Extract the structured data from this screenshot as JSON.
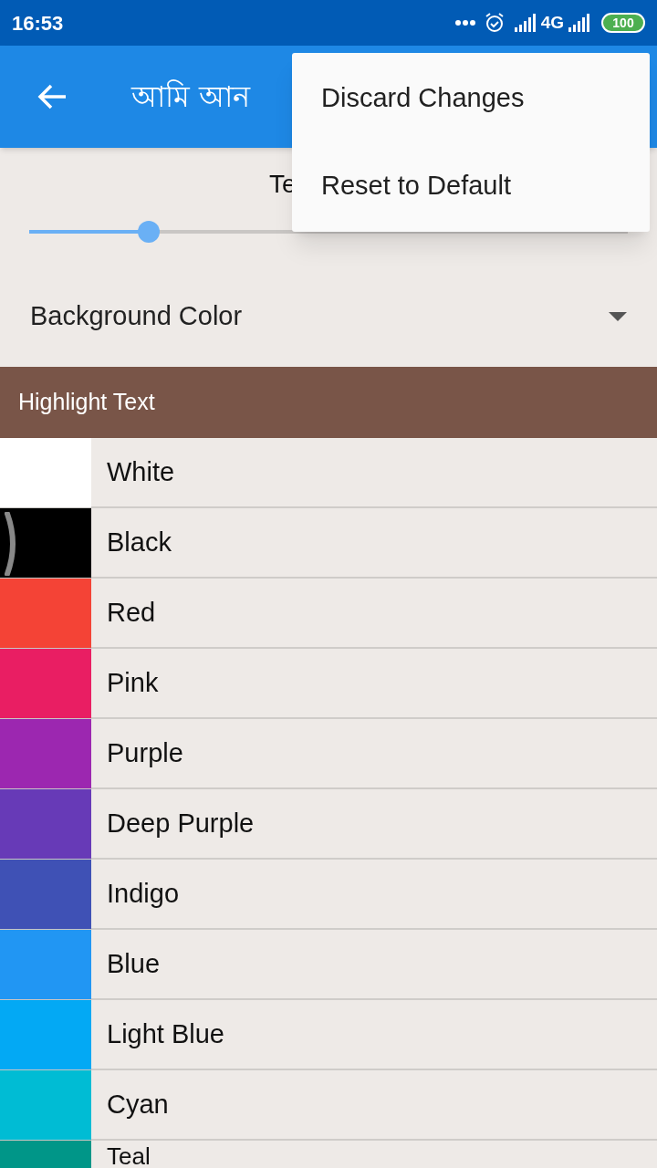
{
  "status_bar": {
    "time": "16:53",
    "network": "4G",
    "battery": "100"
  },
  "app_bar": {
    "title": "আমি আন"
  },
  "menu": {
    "items": [
      "Discard Changes",
      "Reset to Default"
    ]
  },
  "text_size": {
    "label": "Te",
    "level": 0.2
  },
  "background_color": {
    "label": "Background Color"
  },
  "section": {
    "title": "Highlight Text"
  },
  "colors": [
    {
      "label": "White",
      "color": "#ffffff"
    },
    {
      "label": "Black",
      "color": "#000000"
    },
    {
      "label": "Red",
      "color": "#f44336"
    },
    {
      "label": "Pink",
      "color": "#e91e63"
    },
    {
      "label": "Purple",
      "color": "#9c27b0"
    },
    {
      "label": "Deep Purple",
      "color": "#673ab7"
    },
    {
      "label": "Indigo",
      "color": "#3f51b5"
    },
    {
      "label": "Blue",
      "color": "#2196f3"
    },
    {
      "label": "Light Blue",
      "color": "#03a9f4"
    },
    {
      "label": "Cyan",
      "color": "#00bcd4"
    },
    {
      "label": "Teal",
      "color": "#009688"
    }
  ]
}
